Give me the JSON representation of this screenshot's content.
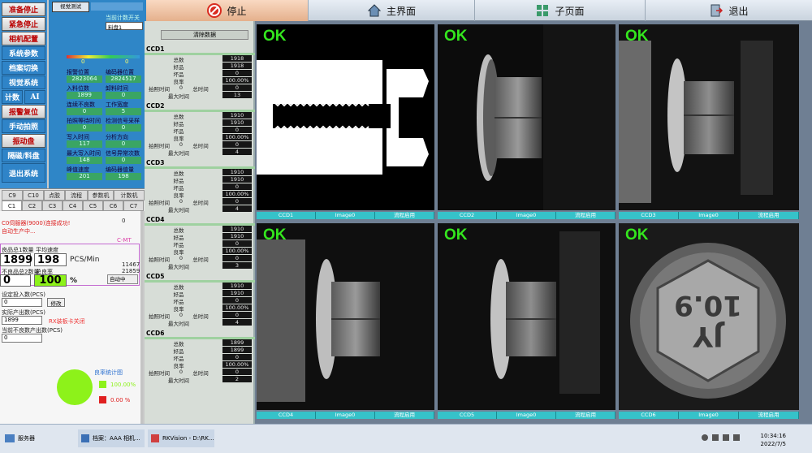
{
  "toolbar": {
    "stop_label": "停止",
    "main_label": "主界面",
    "sub_label": "子页面",
    "exit_label": "退出"
  },
  "left_buttons": [
    "准备停止",
    "紧急停止",
    "相机配置",
    "系统参数",
    "档案切换",
    "视觉系统",
    "计数",
    "AI",
    "报警复位",
    "手动拍照",
    "振动盘",
    "隔磁/料盘",
    "退出系统"
  ],
  "info_panel": {
    "top_label": "视觉测试",
    "counter_label": "当前计数开关",
    "counter_select": "料盘1",
    "value_left": "0",
    "value_right": "0",
    "rows": [
      {
        "a": "报警位置",
        "b": "编码器位置"
      },
      {
        "a": "2823064",
        "b": "2824517"
      },
      {
        "a": "入料位数",
        "b": "卸料时间"
      },
      {
        "a": "1899",
        "b": "0"
      },
      {
        "a": "连续不良数",
        "b": "工作宽度"
      },
      {
        "a": "0",
        "b": "5"
      },
      {
        "a": "拍照等待时间",
        "b": "检测信号采样"
      },
      {
        "a": "0",
        "b": "0"
      },
      {
        "a": "写入时间",
        "b": "分析方向"
      },
      {
        "a": "117",
        "b": "0"
      },
      {
        "a": "最大写入时间",
        "b": "信号异常次数"
      },
      {
        "a": "148",
        "b": "0"
      },
      {
        "a": "峰值速度",
        "b": "编码器值量"
      },
      {
        "a": "201",
        "b": "198"
      }
    ]
  },
  "tabs_row1": [
    "C9",
    "C10",
    "点胶",
    "流程",
    "参数机",
    "计数机"
  ],
  "tabs_row2": [
    "C1",
    "C2",
    "C3",
    "C4",
    "C5",
    "C6",
    "C7"
  ],
  "lower_panel": {
    "msg1": "C0伺服器(9000)连接成功!",
    "msg2": "自动生产中...",
    "top_right": "0",
    "ctr_label": "C-MT",
    "good_label": "良品总1数量",
    "speed_label": "平均速度",
    "good_value": "1899",
    "speed_value": "198",
    "speed_unit": "PCS/Min",
    "bad_label": "不良品总2数量",
    "total_label": "总良率",
    "bad_value": "0",
    "rate_value": "100",
    "rate_unit": "%",
    "n1": "11467",
    "n2": "21859",
    "mode_select": "自动中",
    "label_a": "设定投入数(PCS)",
    "input_a": "0",
    "modify_btn": "修改",
    "label_b": "实际产出数(PCS)",
    "input_b": "1899",
    "red_note": "RX装板卡关闭",
    "label_c": "当前不良数产出数(PCS)",
    "input_c": "0",
    "pie_label": "良率统计图",
    "legend_good": "100.00%",
    "legend_bad": "0.00 %"
  },
  "stats": {
    "clear_btn": "清除数据",
    "sections": [
      {
        "title": "CCD1",
        "total": "1918",
        "good": "1918",
        "bad": "0",
        "rate": "100.00%",
        "shot": "0",
        "total_time": "0",
        "max_time": "13"
      },
      {
        "title": "CCD2",
        "total": "1910",
        "good": "1910",
        "bad": "0",
        "rate": "100.00%",
        "shot": "0",
        "total_time": "0",
        "max_time": "4"
      },
      {
        "title": "CCD3",
        "total": "1910",
        "good": "1910",
        "bad": "0",
        "rate": "100.00%",
        "shot": "0",
        "total_time": "0",
        "max_time": "4"
      },
      {
        "title": "CCD4",
        "total": "1910",
        "good": "1910",
        "bad": "0",
        "rate": "100.00%",
        "shot": "0",
        "total_time": "0",
        "max_time": "3"
      },
      {
        "title": "CCD5",
        "total": "1910",
        "good": "1910",
        "bad": "0",
        "rate": "100.00%",
        "shot": "0",
        "total_time": "0",
        "max_time": "4"
      },
      {
        "title": "CCD6",
        "total": "1899",
        "good": "1899",
        "bad": "0",
        "rate": "100.00%",
        "shot": "0",
        "total_time": "0",
        "max_time": "2"
      }
    ],
    "labels": {
      "total": "总数",
      "good": "好品",
      "bad": "坏品",
      "rate": "良率",
      "shot": "拍照时间",
      "total_time": "总时间",
      "max_time": "最大时间"
    }
  },
  "cameras": [
    {
      "status": "OK",
      "ccd": "CCD1",
      "image": "Image0",
      "flow": "流程启用"
    },
    {
      "status": "OK",
      "ccd": "CCD2",
      "image": "Image0",
      "flow": "流程启用"
    },
    {
      "status": "OK",
      "ccd": "CCD3",
      "image": "Image0",
      "flow": "流程启用"
    },
    {
      "status": "OK",
      "ccd": "CCD4",
      "image": "Image0",
      "flow": "流程启用"
    },
    {
      "status": "OK",
      "ccd": "CCD5",
      "image": "Image0",
      "flow": "流程启用"
    },
    {
      "status": "OK",
      "ccd": "CCD6",
      "image": "Image0",
      "flow": "流程启用"
    }
  ],
  "bolt_marking": {
    "line1": "JY",
    "line2": "10.9"
  },
  "taskbar": {
    "app1": "服务器",
    "app2": "档案：AAA 相机...",
    "app3": "RKVision - D:\\RK...",
    "time": "10:34:16",
    "date": "2022/7/5"
  },
  "colors": {
    "ok_green": "#34e61e",
    "caption_teal": "#36c2c9",
    "value_green": "#3aa564",
    "pie_green": "#8df21a",
    "bad_red": "#e02020"
  }
}
